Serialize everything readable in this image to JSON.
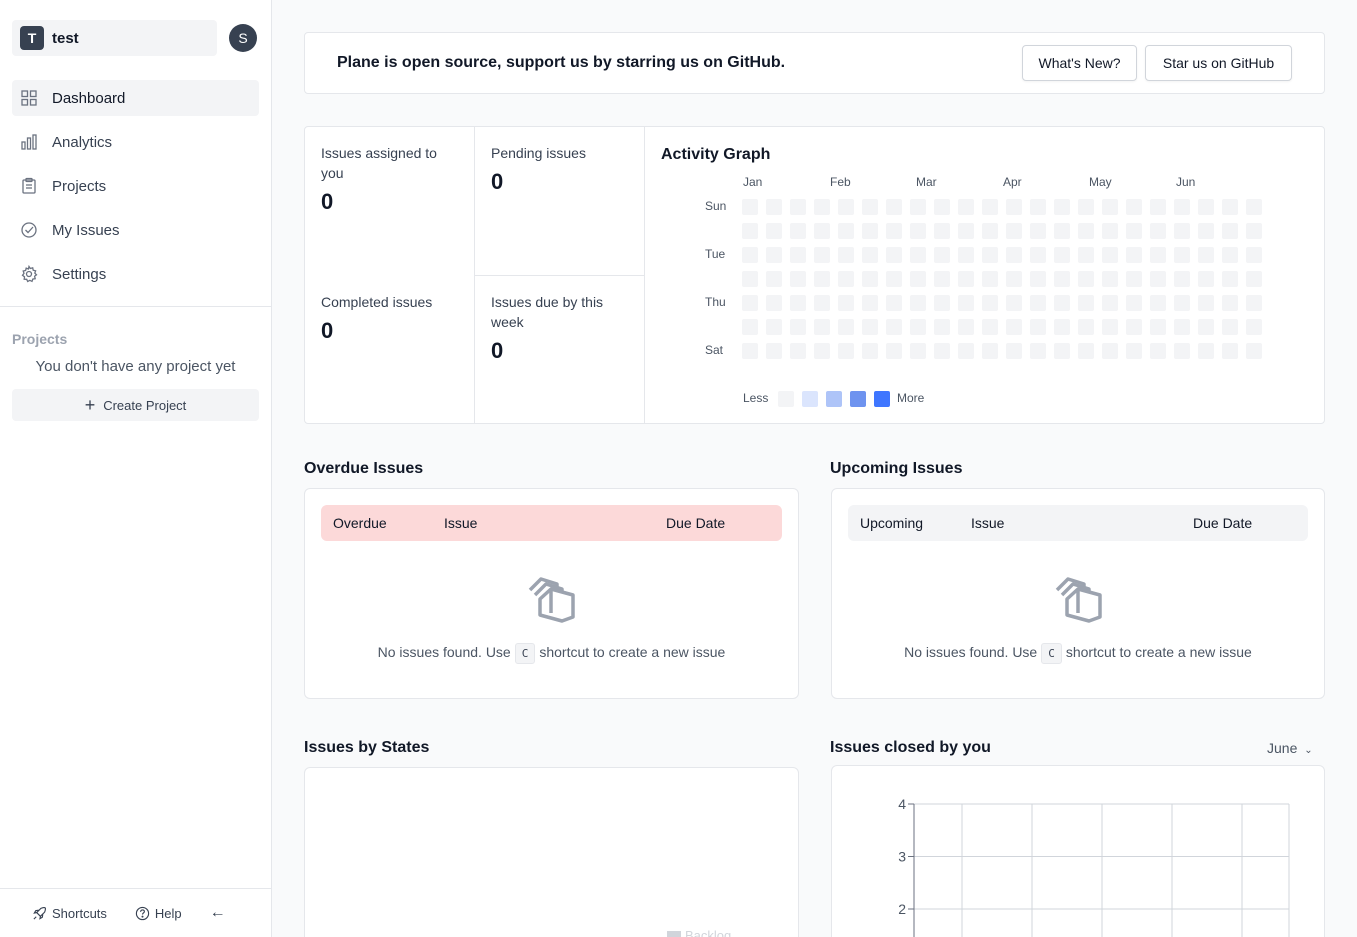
{
  "workspace": {
    "initial": "T",
    "name": "test",
    "user_initial": "S"
  },
  "sidebar": {
    "items": [
      {
        "label": "Dashboard",
        "icon": "grid-icon"
      },
      {
        "label": "Analytics",
        "icon": "bar-chart-icon"
      },
      {
        "label": "Projects",
        "icon": "clipboard-icon"
      },
      {
        "label": "My Issues",
        "icon": "check-circle-icon"
      },
      {
        "label": "Settings",
        "icon": "gear-icon"
      }
    ],
    "projects_heading": "Projects",
    "projects_empty": "You don't have any project yet",
    "create_project_label": "Create Project",
    "footer": {
      "shortcuts": "Shortcuts",
      "help": "Help",
      "collapse": "←"
    }
  },
  "banner": {
    "text": "Plane is open source, support us by starring us on GitHub.",
    "whats_new": "What's New?",
    "star": "Star us on GitHub"
  },
  "stats": {
    "assigned": {
      "label": "Issues assigned to you",
      "value": "0"
    },
    "pending": {
      "label": "Pending issues",
      "value": "0"
    },
    "completed": {
      "label": "Completed issues",
      "value": "0"
    },
    "due_week": {
      "label": "Issues due by this week",
      "value": "0"
    }
  },
  "activity": {
    "title": "Activity Graph",
    "months": [
      "Jan",
      "Feb",
      "Mar",
      "Apr",
      "May",
      "Jun"
    ],
    "days": [
      "Sun",
      "Tue",
      "Thu",
      "Sat"
    ],
    "legend_less": "Less",
    "legend_more": "More",
    "legend_colors": [
      "#f3f4f6",
      "#dbe5fd",
      "#aec4f8",
      "#6e93ef",
      "#3f76ff"
    ]
  },
  "overdue": {
    "title": "Overdue Issues",
    "col1": "Overdue",
    "col2": "Issue",
    "col3": "Due Date",
    "empty_prefix": "No issues found. Use",
    "shortcut_key": "C",
    "empty_suffix": "shortcut to create a new issue"
  },
  "upcoming": {
    "title": "Upcoming Issues",
    "col1": "Upcoming",
    "col2": "Issue",
    "col3": "Due Date",
    "empty_prefix": "No issues found. Use",
    "shortcut_key": "C",
    "empty_suffix": "shortcut to create a new issue"
  },
  "states": {
    "title": "Issues by States",
    "legend_partial": "Backlog"
  },
  "closed": {
    "title": "Issues closed by you",
    "month": "June",
    "chart_data": {
      "type": "line",
      "y_ticks": [
        "4",
        "3",
        "2"
      ],
      "ylim": [
        0,
        4
      ],
      "series": []
    }
  }
}
